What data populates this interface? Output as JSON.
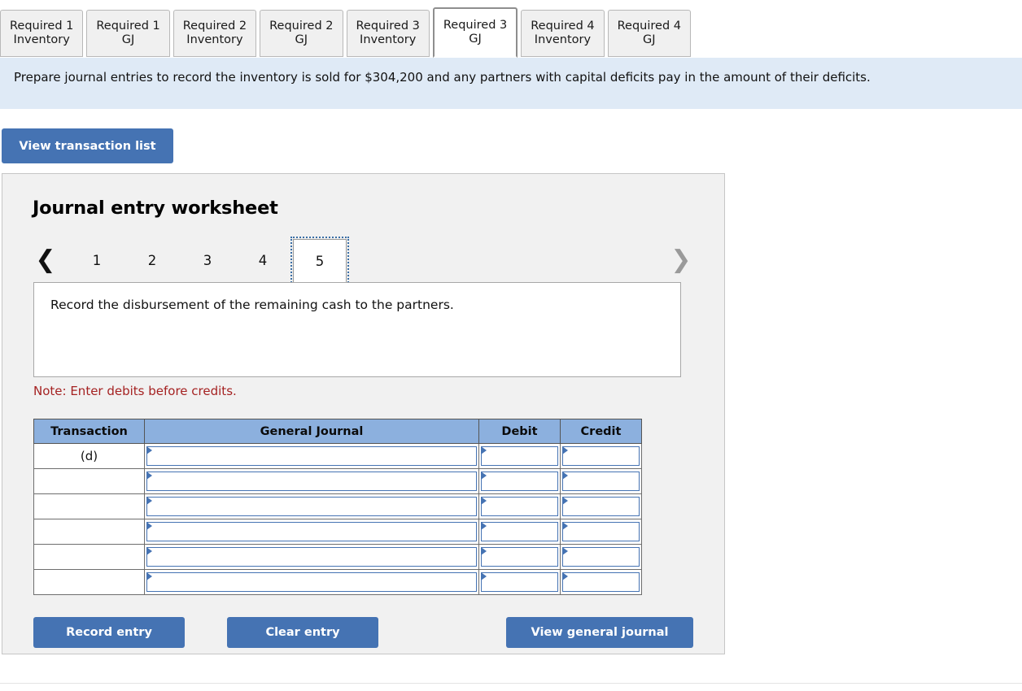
{
  "tabs": [
    {
      "line1": "Required 1",
      "line2": "Inventory",
      "active": false
    },
    {
      "line1": "Required 1",
      "line2": "GJ",
      "active": false
    },
    {
      "line1": "Required 2",
      "line2": "Inventory",
      "active": false
    },
    {
      "line1": "Required 2",
      "line2": "GJ",
      "active": false
    },
    {
      "line1": "Required 3",
      "line2": "Inventory",
      "active": false
    },
    {
      "line1": "Required 3",
      "line2": "GJ",
      "active": true
    },
    {
      "line1": "Required 4",
      "line2": "Inventory",
      "active": false
    },
    {
      "line1": "Required 4",
      "line2": "GJ",
      "active": false
    }
  ],
  "banner": {
    "text": "Prepare journal entries to record the inventory is sold for $304,200 and any partners with capital deficits pay in the amount of their deficits."
  },
  "toolbar": {
    "view_transaction_list_label": "View transaction list"
  },
  "worksheet": {
    "title": "Journal entry worksheet",
    "pager": {
      "prev_icon": "chevron-left-icon",
      "next_icon": "chevron-right-icon",
      "pages": [
        "1",
        "2",
        "3",
        "4",
        "5"
      ],
      "current": "5"
    },
    "description": "Record the disbursement of the remaining cash to the partners.",
    "note": "Note: Enter debits before credits.",
    "table": {
      "columns": [
        "Transaction",
        "General Journal",
        "Debit",
        "Credit"
      ],
      "rows": [
        {
          "transaction": "(d)",
          "general_journal": "",
          "debit": "",
          "credit": ""
        },
        {
          "transaction": "",
          "general_journal": "",
          "debit": "",
          "credit": ""
        },
        {
          "transaction": "",
          "general_journal": "",
          "debit": "",
          "credit": ""
        },
        {
          "transaction": "",
          "general_journal": "",
          "debit": "",
          "credit": ""
        },
        {
          "transaction": "",
          "general_journal": "",
          "debit": "",
          "credit": ""
        },
        {
          "transaction": "",
          "general_journal": "",
          "debit": "",
          "credit": ""
        }
      ]
    },
    "buttons": {
      "record_entry": "Record entry",
      "clear_entry": "Clear entry",
      "view_general_journal": "View general journal"
    }
  },
  "colors": {
    "button_blue": "#4573b3",
    "table_header_blue": "#8cb0de",
    "banner_blue": "#dfeaf6",
    "panel_gray": "#f1f1f1",
    "note_red": "#a52222",
    "input_border_blue": "#4573b3"
  }
}
